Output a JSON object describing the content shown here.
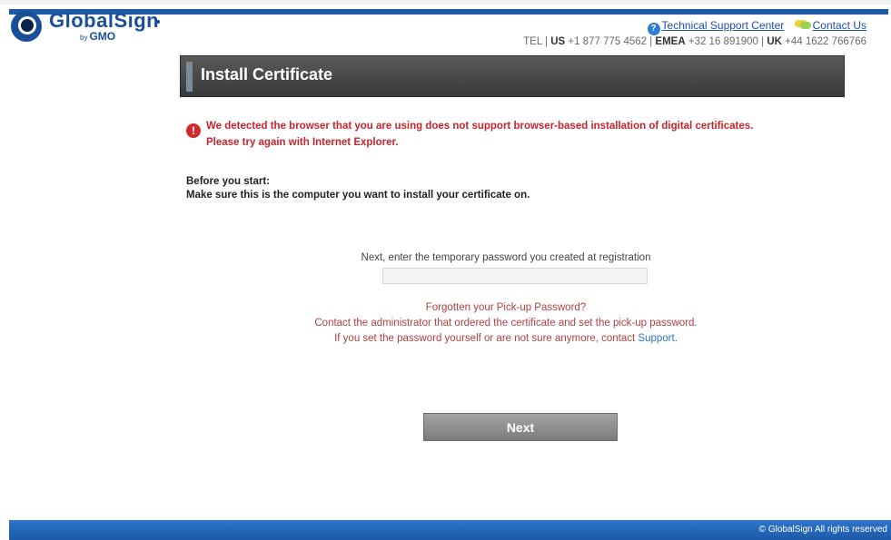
{
  "logo": {
    "word": "GlobalSign",
    "sub_prefix": "by",
    "sub": "GMO"
  },
  "header": {
    "support_link": "Technical Support Center",
    "contact_link": "Contact Us",
    "tel_label": "TEL |",
    "us_code": "US",
    "us_number": "+1 877 775 4562 |",
    "emea_code": "EMEA",
    "emea_number": "+32 16 891900 |",
    "uk_code": "UK",
    "uk_number": "+44 1622 766766"
  },
  "title": "Install Certificate",
  "error": {
    "line1": "We detected the browser that you are using does not support browser-based installation of digital certificates.",
    "line2": "Please try again with Internet Explorer."
  },
  "before": {
    "line1": "Before you start:",
    "line2": "Make sure this is the computer you want to install your certificate on."
  },
  "password": {
    "label": "Next, enter the temporary password you created at registration",
    "value": "",
    "placeholder": ""
  },
  "help": {
    "line1": "Forgotten your Pick-up Password?",
    "line2": "Contact the administrator that ordered the certificate and set the pick-up password.",
    "line3": "If you set the password yourself or are not sure anymore, contact",
    "support_link": "Support",
    "period": "."
  },
  "next_button": "Next",
  "footer": "© GlobalSign All rights reserved",
  "colors": {
    "brand_blue": "#1c5aa8",
    "error_red": "#c6262e",
    "help_red": "#b04040",
    "banner_dark": "#3a3a3a"
  },
  "icons": {
    "support": "help-circle-icon",
    "contact": "chat-bubbles-icon",
    "error": "exclamation-circle-icon"
  }
}
